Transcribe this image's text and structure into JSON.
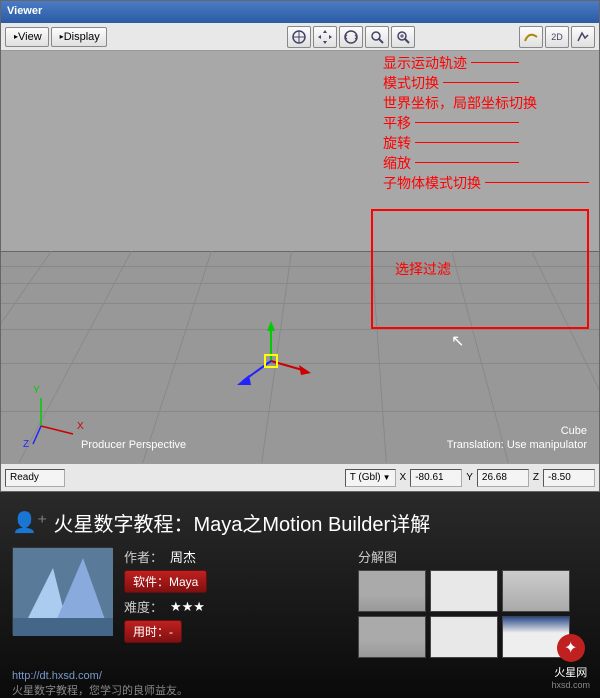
{
  "window": {
    "title": "Viewer"
  },
  "toolbar": {
    "view": "View",
    "display": "Display"
  },
  "viewport": {
    "perspective_label": "Producer Perspective",
    "object_label": "Cube",
    "hint": "Translation: Use manipulator",
    "axis_x": "X",
    "axis_y": "Y",
    "axis_z": "Z"
  },
  "annotations": {
    "trajectory": "显示运动轨迹",
    "mode_switch": "模式切换",
    "coord_switch": "世界坐标，局部坐标切换",
    "translate": "平移",
    "rotate": "旋转",
    "scale": "缩放",
    "child_mode": "子物体模式切换",
    "select_filter": "选择过滤"
  },
  "status": {
    "ready": "Ready",
    "t_label": "T (Gbl)",
    "x_label": "X",
    "x_val": "-80.61",
    "y_label": "Y",
    "y_val": "26.68",
    "z_label": "Z",
    "z_val": "-8.50"
  },
  "article": {
    "title": "火星数字教程：Maya之Motion Builder详解",
    "author_label": "作者：",
    "author": "周杰",
    "software_label": "软件：",
    "software": "Maya",
    "difficulty_label": "难度：",
    "stars": "★★★",
    "time_label": "用时：",
    "time": "-",
    "thumbs_title": "分解图",
    "url": "http://dt.hxsd.com/",
    "tagline": "火星数字教程，您学习的良师益友。",
    "brand": "火星网",
    "brand_sub": "hxsd.com"
  }
}
